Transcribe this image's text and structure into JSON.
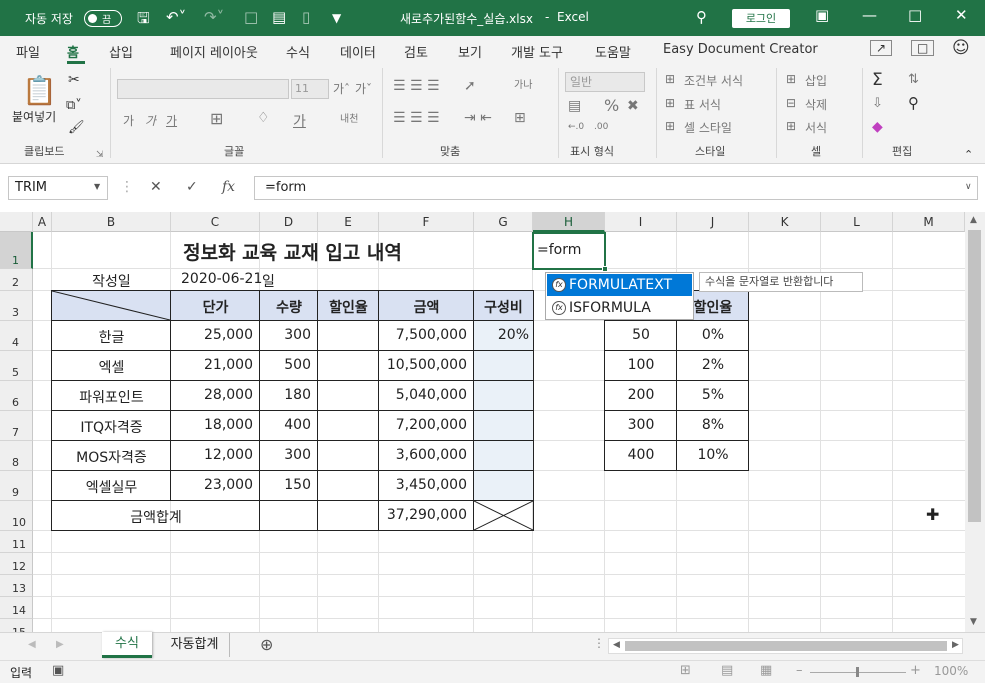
{
  "titlebar": {
    "autosave_label": "자동 저장",
    "toggle_state": "끔",
    "filename": "새로추가된함수_실습.xlsx",
    "app": "Excel",
    "login": "로그인"
  },
  "menu": [
    "파일",
    "홈",
    "삽입",
    "페이지 레이아웃",
    "수식",
    "데이터",
    "검토",
    "보기",
    "개발 도구",
    "도움말",
    "Easy Document Creator"
  ],
  "ribbon": {
    "groups": [
      "클립보드",
      "글꼴",
      "맞춤",
      "표시 형식",
      "스타일",
      "셀",
      "편집"
    ],
    "paste_label": "붙여넣기",
    "font_size": "11",
    "number_format": "일반",
    "conditional_format": "조건부 서식",
    "table_format": "표 서식",
    "cell_style": "셀 스타일",
    "insert": "삽입",
    "delete": "삭제",
    "format": "서식"
  },
  "formula_bar": {
    "name_box": "TRIM",
    "formula": "=form",
    "fx": "fx"
  },
  "columns": [
    "A",
    "B",
    "C",
    "D",
    "E",
    "F",
    "G",
    "H",
    "I",
    "J",
    "K",
    "L",
    "M"
  ],
  "rows": [
    "1",
    "2",
    "3",
    "4",
    "5",
    "6",
    "7",
    "8",
    "9",
    "10",
    "11",
    "12",
    "13",
    "14",
    "15"
  ],
  "sheet": {
    "title": "정보화 교육 교재 입고 내역",
    "created_label": "작성일",
    "created_date": "2020-06-21",
    "created_day": "일",
    "headers": [
      "단가",
      "수량",
      "할인율",
      "금액",
      "구성비"
    ],
    "items": [
      {
        "name": "한글",
        "price": "25,000",
        "qty": "300",
        "amount": "7,500,000",
        "ratio": "20%"
      },
      {
        "name": "엑셀",
        "price": "21,000",
        "qty": "500",
        "amount": "10,500,000",
        "ratio": ""
      },
      {
        "name": "파워포인트",
        "price": "28,000",
        "qty": "180",
        "amount": "5,040,000",
        "ratio": ""
      },
      {
        "name": "ITQ자격증",
        "price": "18,000",
        "qty": "400",
        "amount": "7,200,000",
        "ratio": ""
      },
      {
        "name": "MOS자격증",
        "price": "12,000",
        "qty": "300",
        "amount": "3,600,000",
        "ratio": ""
      },
      {
        "name": "엑셀실무",
        "price": "23,000",
        "qty": "150",
        "amount": "3,450,000",
        "ratio": ""
      }
    ],
    "total_label": "금액합계",
    "total_amount": "37,290,000",
    "editing_cell": "=form",
    "discount_header": "할인율",
    "discount_table": [
      [
        "50",
        "0%"
      ],
      [
        "100",
        "2%"
      ],
      [
        "200",
        "5%"
      ],
      [
        "300",
        "8%"
      ],
      [
        "400",
        "10%"
      ]
    ]
  },
  "autocomplete": {
    "items": [
      "FORMULATEXT",
      "ISFORMULA"
    ],
    "tooltip": "수식을 문자열로 반환합니다"
  },
  "sheet_tabs": [
    "수식",
    "자동합계"
  ],
  "status": {
    "mode": "입력",
    "zoom": "100%"
  },
  "colors": {
    "excel_green": "#217346",
    "header_fill": "#d9e1f2",
    "ratio_fill": "#eaf1f8",
    "selection": "#0078d7"
  }
}
